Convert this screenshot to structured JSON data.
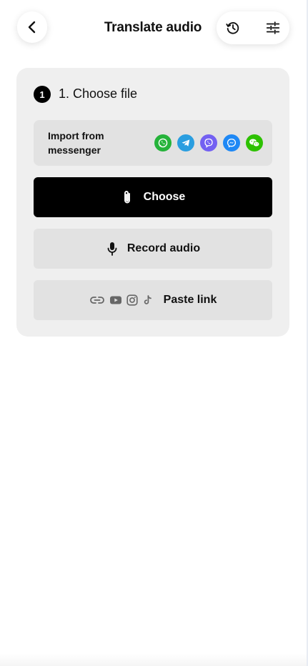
{
  "header": {
    "title": "Translate audio",
    "back_icon": "chevron-left-icon",
    "history_icon": "history-icon",
    "settings_icon": "sliders-icon"
  },
  "step": {
    "number": "1",
    "title": "1. Choose file"
  },
  "import": {
    "label": "Import from messenger",
    "messengers": [
      {
        "name": "whatsapp-icon",
        "color": "#25b33a"
      },
      {
        "name": "telegram-icon",
        "color": "#2a9ee0"
      },
      {
        "name": "viber-icon",
        "color": "#7360f2"
      },
      {
        "name": "messenger-icon",
        "color": "#1e88f5"
      },
      {
        "name": "wechat-icon",
        "color": "#2dc100"
      }
    ]
  },
  "buttons": {
    "choose_label": "Choose",
    "record_label": "Record audio",
    "paste_label": "Paste link"
  },
  "colors": {
    "accent": "#000000",
    "card_bg": "#efefef",
    "button_bg": "#e2e2e2"
  }
}
